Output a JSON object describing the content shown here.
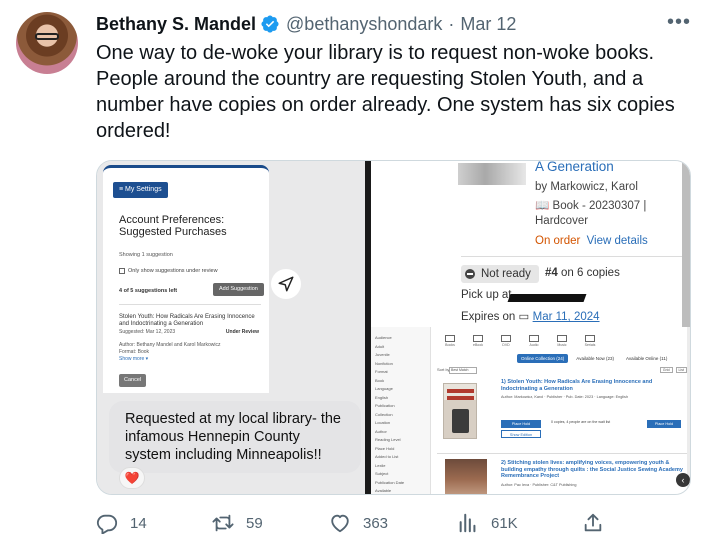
{
  "author": {
    "name": "Bethany S. Mandel",
    "handle": "@bethanyshondark",
    "separator": "·",
    "date": "Mar 12",
    "verified": true
  },
  "more_icon": "more-horizontal-icon",
  "tweet_text": "One way to de-woke your library is to request non-woke books. People around the country are requesting Stolen Youth, and a number have copies on order already. One system has six copies ordered!",
  "media": {
    "left": {
      "settings_button": "≡ My Settings",
      "title": "Account Preferences: Suggested Purchases",
      "showing": "Showing 1 suggestion",
      "checkbox_label": "Only show suggestions under review",
      "suggestions_left": "4 of 5 suggestions left",
      "add_button": "Add Suggestion",
      "book_title": "Stolen Youth: How Radicals Are Erasing Innocence and Indoctrinating a Generation",
      "suggested_date": "Suggested: Mar 12, 2023",
      "status": "Under Review",
      "author_line": "Author: Bethany Mandel and Karol Markowicz",
      "format_line": "Format: Book",
      "show_more": "Show more ▾",
      "cancel_button": "Cancel",
      "message": "Requested at my local library- the infamous Hennepin County system including Minneapolis!!",
      "reaction": "❤️"
    },
    "right_top": {
      "title_fragment": "A Generation",
      "by": "by Markowicz, Karol",
      "format": "Book - 20230307 | Hardcover",
      "on_order": "On order",
      "view_details": "View details",
      "status_chip": "Not ready",
      "queue_position": "#4",
      "queue_rest": "on 6 copies",
      "pickup_label": "Pick up at",
      "expires_label": "Expires on",
      "expires_date": "Mar 11, 2024"
    },
    "right_bottom": {
      "sidebar": [
        "Audience",
        "Adult",
        "Juvenile",
        "Nonfiction",
        "Format",
        "Book",
        "Language",
        "English",
        "Publication",
        "Collection",
        "Location",
        "Author",
        "Reading Level",
        "Place Hold",
        "Added to List",
        "Lexile",
        "Subject",
        "Publication Date",
        "Available"
      ],
      "formats": [
        "Books",
        "eBook",
        "DVD",
        "Audio",
        "Music",
        "Serials"
      ],
      "tabs": [
        "Online Collection (24)",
        "Available Now (23)",
        "Available Online (11)"
      ],
      "sort_label": "Sort by",
      "sort_value": "Best Match",
      "view_buttons": [
        "Grid",
        "List"
      ],
      "result1_title": "1) Stolen Youth: How Radicals Are Erasing Innocence and Indoctrinating a Generation",
      "result1_meta": "Author: Markowicz, Karol · Publisher · Pub. Date: 2023 · Language: English",
      "hold_button": "Place Hold",
      "details_button": "Show Edition",
      "availability": "0 copies, 4 people are on the wait list",
      "result2_title": "2) Stitching stolen lives: amplifying voices, empowering youth & building empathy through quilts : the Social Justice Sewing Academy Remembrance Project",
      "result2_meta": "Author: Pac Ieva · Publisher: C&T Publishing"
    }
  },
  "actions": {
    "reply_count": "14",
    "retweet_count": "59",
    "like_count": "363",
    "views_count": "61K"
  },
  "colors": {
    "text": "#0f1419",
    "secondary": "#536471",
    "verified": "#1d9bf0",
    "link": "#2a6eb8",
    "on_order": "#d35400"
  }
}
